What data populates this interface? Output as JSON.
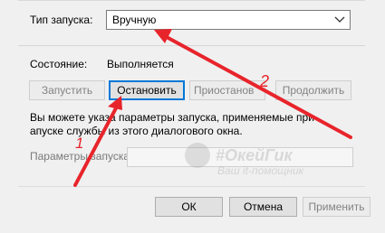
{
  "startup": {
    "label": "Тип запуска:",
    "value": "Вручную"
  },
  "status": {
    "label": "Состояние:",
    "value": "Выполняется"
  },
  "buttons": {
    "start": "Запустить",
    "stop": "Остановить",
    "pause": "Приостанов",
    "resume": "Продолжить"
  },
  "description": "Вы можете указа  параметры запуска, применяемые при  апуске службы из этого диалогового окна.",
  "params": {
    "label": "Параметры запуска:",
    "value": ""
  },
  "footer": {
    "ok": "ОК",
    "cancel": "Отмена",
    "apply": "Применить"
  },
  "watermark": {
    "title": "#ОкейГик",
    "subtitle": "Ваш it-помощник"
  },
  "annotations": {
    "marker_1": "1",
    "marker_2": "2",
    "arrow_color": "#e8242b"
  }
}
